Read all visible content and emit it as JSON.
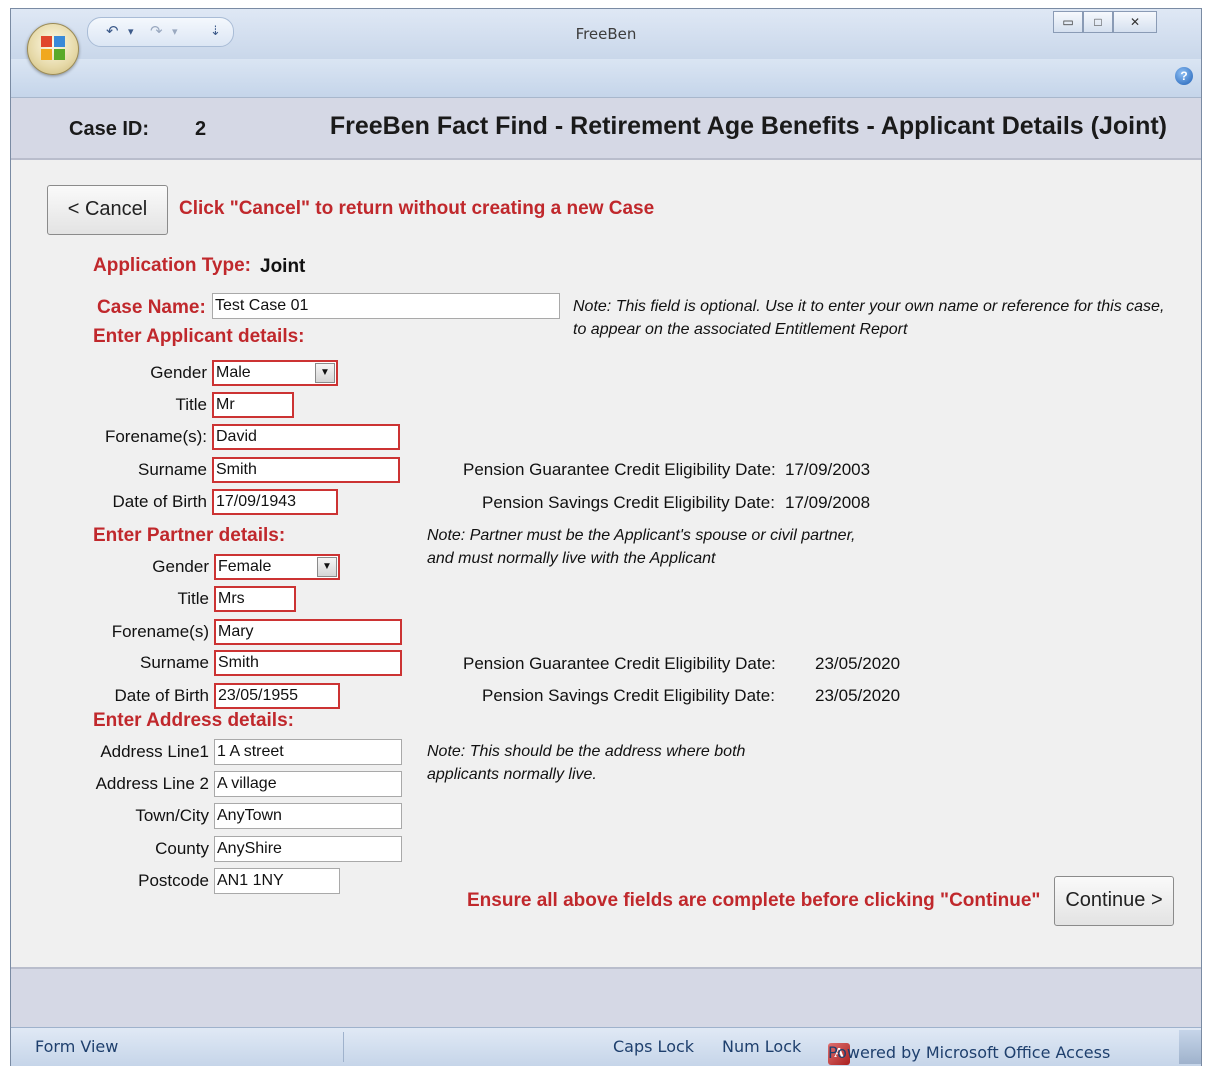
{
  "window": {
    "title": "FreeBen",
    "controls": {
      "minimize": "▭",
      "maximize": "□",
      "close": "✕"
    },
    "qat": {
      "undo": "↶",
      "dropdown1": "▾",
      "redo": "↷",
      "dropdown2": "▾",
      "customize": "⇣"
    },
    "help": "?"
  },
  "header": {
    "case_id_label": "Case ID:",
    "case_id_value": "2",
    "title": "FreeBen Fact Find - Retirement Age Benefits - Applicant Details (Joint)"
  },
  "cancel": {
    "label": "< Cancel",
    "hint": "Click \"Cancel\" to return without creating a new Case"
  },
  "application_type": {
    "label": "Application Type:",
    "value": "Joint"
  },
  "case_name": {
    "label": "Case Name:",
    "value": "Test Case 01",
    "note": "Note:  This field is optional. Use it to enter your own name or reference for this case, to appear on the associated Entitlement Report"
  },
  "applicant": {
    "heading": "Enter Applicant details:",
    "gender_label": "Gender",
    "gender_value": "Male",
    "title_label": "Title",
    "title_value": "Mr",
    "forename_label": "Forename(s):",
    "forename_value": "David",
    "surname_label": "Surname",
    "surname_value": "Smith",
    "dob_label": "Date of Birth",
    "dob_value": "17/09/1943",
    "pgc_label": "Pension Guarantee Credit Eligibility Date:",
    "pgc_value": "17/09/2003",
    "psc_label": "Pension Savings Credit Eligibility Date:",
    "psc_value": "17/09/2008"
  },
  "partner": {
    "heading": "Enter Partner details:",
    "note": "Note:  Partner must be the Applicant's spouse or civil partner, and must normally live with the Applicant",
    "gender_label": "Gender",
    "gender_value": "Female",
    "title_label": "Title",
    "title_value": "Mrs",
    "forename_label": "Forename(s)",
    "forename_value": "Mary",
    "surname_label": "Surname",
    "surname_value": "Smith",
    "dob_label": "Date of Birth",
    "dob_value": "23/05/1955",
    "pgc_label": "Pension Guarantee Credit Eligibility Date:",
    "pgc_value": "23/05/2020",
    "psc_label": "Pension Savings Credit Eligibility Date:",
    "psc_value": "23/05/2020"
  },
  "address": {
    "heading": "Enter Address details:",
    "note": "Note: This should be the address where both applicants normally live.",
    "line1_label": "Address Line1",
    "line1_value": "1 A street",
    "line2_label": "Address Line 2",
    "line2_value": "A village",
    "town_label": "Town/City",
    "town_value": "AnyTown",
    "county_label": "County",
    "county_value": "AnyShire",
    "postcode_label": "Postcode",
    "postcode_value": "AN1 1NY"
  },
  "continue": {
    "hint": "Ensure all above fields are complete before clicking \"Continue\"",
    "label": "Continue >"
  },
  "statusbar": {
    "view": "Form View",
    "caps": "Caps Lock",
    "num": "Num Lock",
    "powered": "Powered by Microsoft Office Access",
    "access_glyph": "A"
  }
}
